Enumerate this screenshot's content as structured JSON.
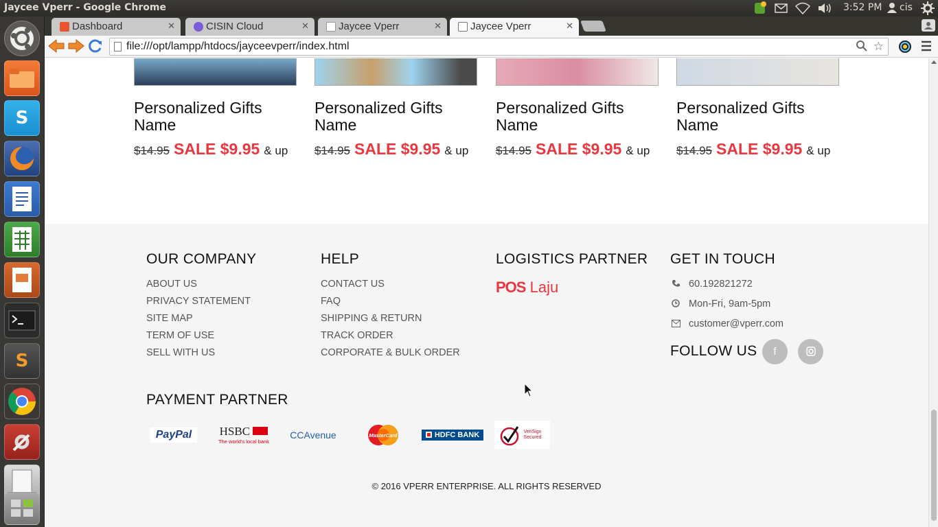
{
  "os": {
    "window_title": "Jaycee Vperr - Google Chrome",
    "clock": "3:52 PM",
    "user": "cis"
  },
  "browser": {
    "tabs": [
      {
        "label": "Dashboard",
        "favicon_color": "#e8542f"
      },
      {
        "label": "CISIN Cloud",
        "favicon_color": "#7b5bd6"
      },
      {
        "label": "Jaycee Vperr",
        "favicon_color": "#ffffff"
      },
      {
        "label": "Jaycee Vperr",
        "favicon_color": "#ffffff"
      }
    ],
    "url": "file:///opt/lampp/htdocs/jayceevperr/index.html"
  },
  "products": [
    {
      "name": "Personalized Gifts Name",
      "old_price": "$14.95",
      "sale_price": "SALE $9.95",
      "suffix": "& up"
    },
    {
      "name": "Personalized Gifts Name",
      "old_price": "$14.95",
      "sale_price": "SALE $9.95",
      "suffix": "& up"
    },
    {
      "name": "Personalized Gifts Name",
      "old_price": "$14.95",
      "sale_price": "SALE $9.95",
      "suffix": "& up"
    },
    {
      "name": "Personalized Gifts Name",
      "old_price": "$14.95",
      "sale_price": "SALE $9.95",
      "suffix": "& up"
    }
  ],
  "footer": {
    "company": {
      "heading": "OUR COMPANY",
      "links": [
        "ABOUT US",
        "PRIVACY STATEMENT",
        "SITE MAP",
        "TERM OF USE",
        "SELL WITH US"
      ]
    },
    "help": {
      "heading": "HELP",
      "links": [
        "CONTACT US",
        "FAQ",
        "SHIPPING & RETURN",
        "TRACK ORDER",
        "CORPORATE & BULK ORDER"
      ]
    },
    "logistics": {
      "heading": "LOGISTICS PARTNER",
      "logo_text_a": "POS",
      "logo_text_b": "Laju"
    },
    "contact": {
      "heading": "GET IN TOUCH",
      "phone": "60.192821272",
      "hours": "Mon-Fri, 9am-5pm",
      "email": "customer@vperr.com",
      "follow_heading": "FOLLOW US",
      "social_icons": [
        "facebook-icon",
        "instagram-icon"
      ]
    },
    "payment": {
      "heading": "PAYMENT PARTNER",
      "logos": [
        {
          "name": "PayPal",
          "text": "PayPal"
        },
        {
          "name": "HSBC",
          "text": "HSBC",
          "subtext": "The world's local bank"
        },
        {
          "name": "CCAvenue",
          "text": "CCAvenue"
        },
        {
          "name": "MasterCard",
          "text": "MasterCard"
        },
        {
          "name": "HDFC BANK",
          "text": "HDFC BANK"
        },
        {
          "name": "VeriSign Secured",
          "text": "VeriSign Secured"
        }
      ]
    },
    "copyright": "© 2016 VPERR ENTERPRISE. ALL RIGHTS RESERVED"
  },
  "colors": {
    "sale_red": "#e8373f",
    "footer_bg": "#f5f5f5",
    "pos_red": "#e8373f",
    "paypal_blue": "#1d3f8c"
  }
}
